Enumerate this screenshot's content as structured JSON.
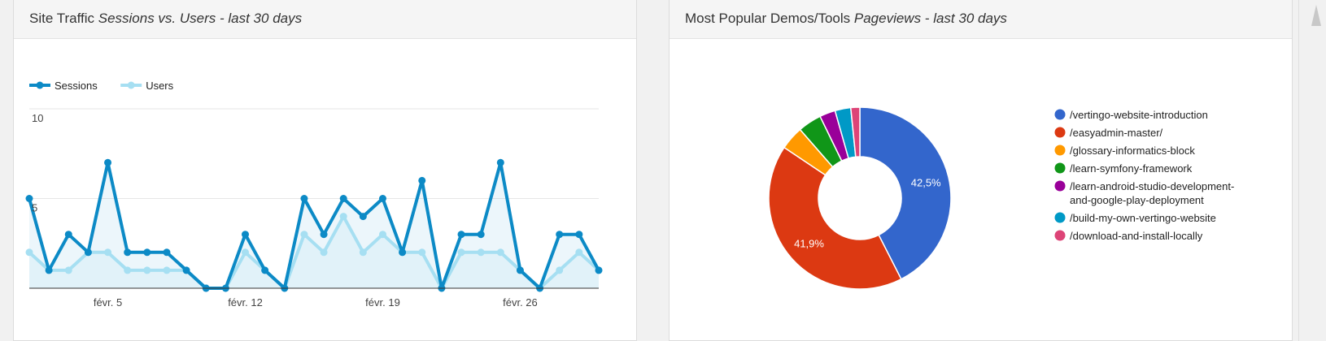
{
  "traffic_panel": {
    "title": "Site Traffic",
    "subtitle": "Sessions vs. Users - last 30 days"
  },
  "popular_panel": {
    "title": "Most Popular Demos/Tools",
    "subtitle": "Pageviews - last 30 days"
  },
  "chart_data": [
    {
      "type": "area",
      "title": "",
      "xlabel": "",
      "ylabel": "",
      "ylim": [
        0,
        10
      ],
      "y_ticks": [
        "10",
        "5"
      ],
      "x_tick_labels": [
        "févr. 5",
        "févr. 12",
        "févr. 19",
        "févr. 26"
      ],
      "legend_position": "top-left",
      "grid": true,
      "series": [
        {
          "name": "Sessions",
          "color": "#0c8ac6",
          "values": [
            5,
            1,
            3,
            2,
            7,
            2,
            2,
            2,
            1,
            0,
            0,
            3,
            1,
            0,
            5,
            3,
            5,
            4,
            5,
            2,
            6,
            0,
            3,
            3,
            7,
            1,
            0,
            3,
            3,
            1
          ]
        },
        {
          "name": "Users",
          "color": "#a6dff2",
          "values": [
            2,
            1,
            1,
            2,
            2,
            1,
            1,
            1,
            1,
            0,
            0,
            2,
            1,
            0,
            3,
            2,
            4,
            2,
            3,
            2,
            2,
            0,
            2,
            2,
            2,
            1,
            0,
            1,
            2,
            1
          ]
        }
      ]
    },
    {
      "type": "pie",
      "donut": true,
      "legend_position": "right",
      "slices": [
        {
          "label": "/vertingo-website-introduction",
          "value": 42.5,
          "display": "42,5%",
          "color": "#3366cc"
        },
        {
          "label": "/easyadmin-master/",
          "value": 41.9,
          "display": "41,9%",
          "color": "#dc3912"
        },
        {
          "label": "/glossary-informatics-block",
          "value": 4.2,
          "display": "",
          "color": "#ff9900"
        },
        {
          "label": "/learn-symfony-framework",
          "value": 4.2,
          "display": "",
          "color": "#109618"
        },
        {
          "label": "/learn-android-studio-development-and-google-play-deployment",
          "label_lines": [
            "/learn-android-studio-development-",
            "and-google-play-deployment"
          ],
          "value": 2.8,
          "display": "",
          "color": "#990099"
        },
        {
          "label": "/build-my-own-vertingo-website",
          "value": 2.8,
          "display": "",
          "color": "#0099c6"
        },
        {
          "label": "/download-and-install-locally",
          "value": 1.6,
          "display": "",
          "color": "#dd4477"
        }
      ]
    }
  ]
}
